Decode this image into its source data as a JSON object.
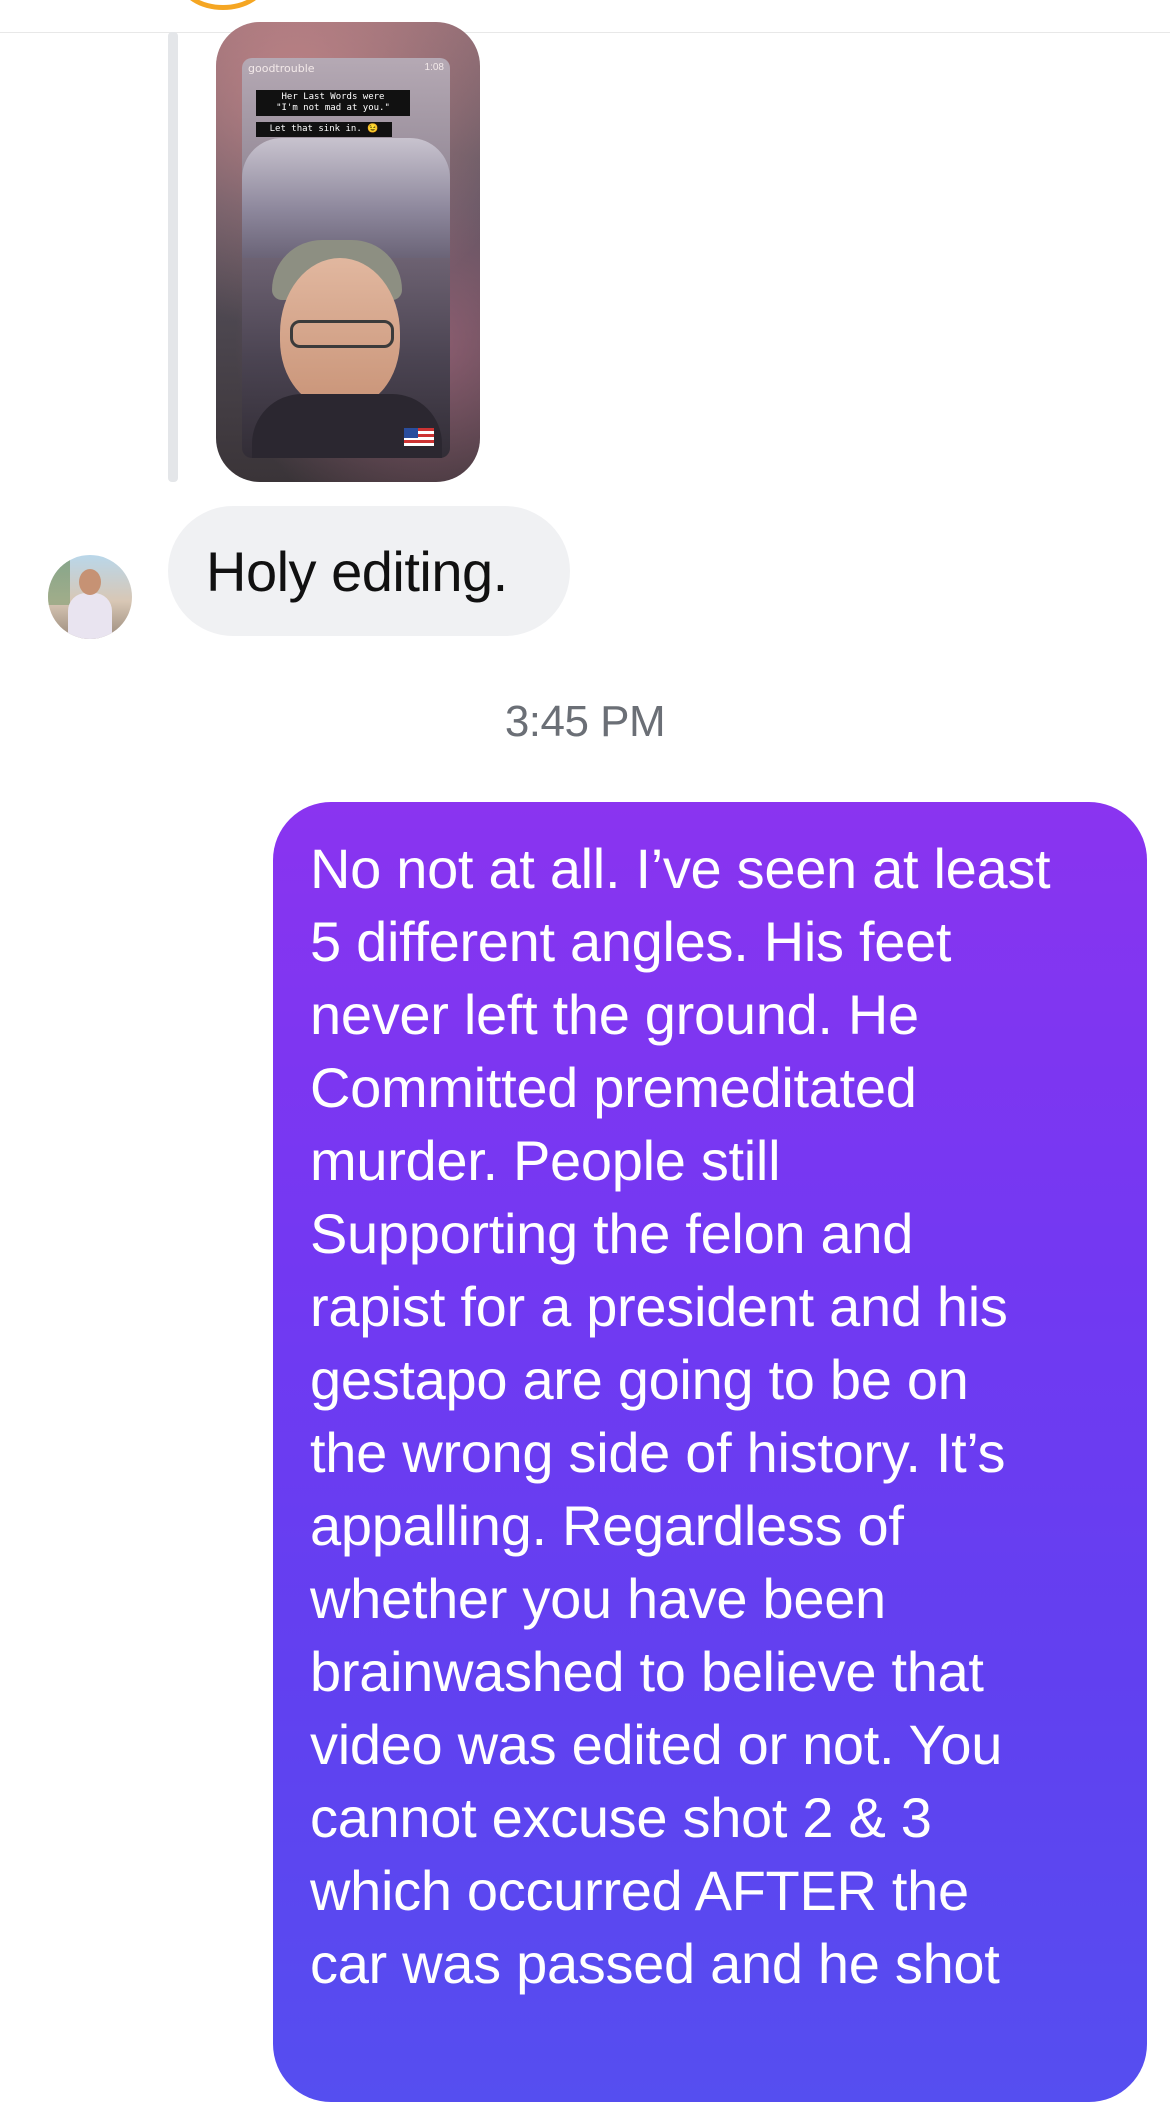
{
  "story": {
    "handle": "goodtrouble",
    "time": "1:08",
    "caption_line1": "Her Last Words were\n\"I'm not mad at you.\"",
    "caption_line2": "Let that sink in. 😉"
  },
  "incoming_message": {
    "text": "Holy editing."
  },
  "timestamp": "3:45 PM",
  "outgoing_message": {
    "lines": [
      "No not at all. I’ve seen at least",
      "5 different angles. His feet",
      "never left the ground. He",
      "Committed premeditated",
      "murder. People still",
      "Supporting the felon and",
      "rapist for a president and his",
      "gestapo are going to be on",
      "the wrong side of history. It’s",
      "appalling. Regardless of",
      "whether you have been",
      "brainwashed to believe that",
      "video was edited or not. You",
      "cannot excuse shot 2 & 3",
      "which occurred AFTER the",
      "car was passed and he shot"
    ]
  },
  "colors": {
    "outgoing_bubble_top": "#8a34f0",
    "outgoing_bubble_bottom": "#554ef0",
    "incoming_bubble": "#f0f1f3",
    "timestamp_text": "#6b6f76"
  }
}
